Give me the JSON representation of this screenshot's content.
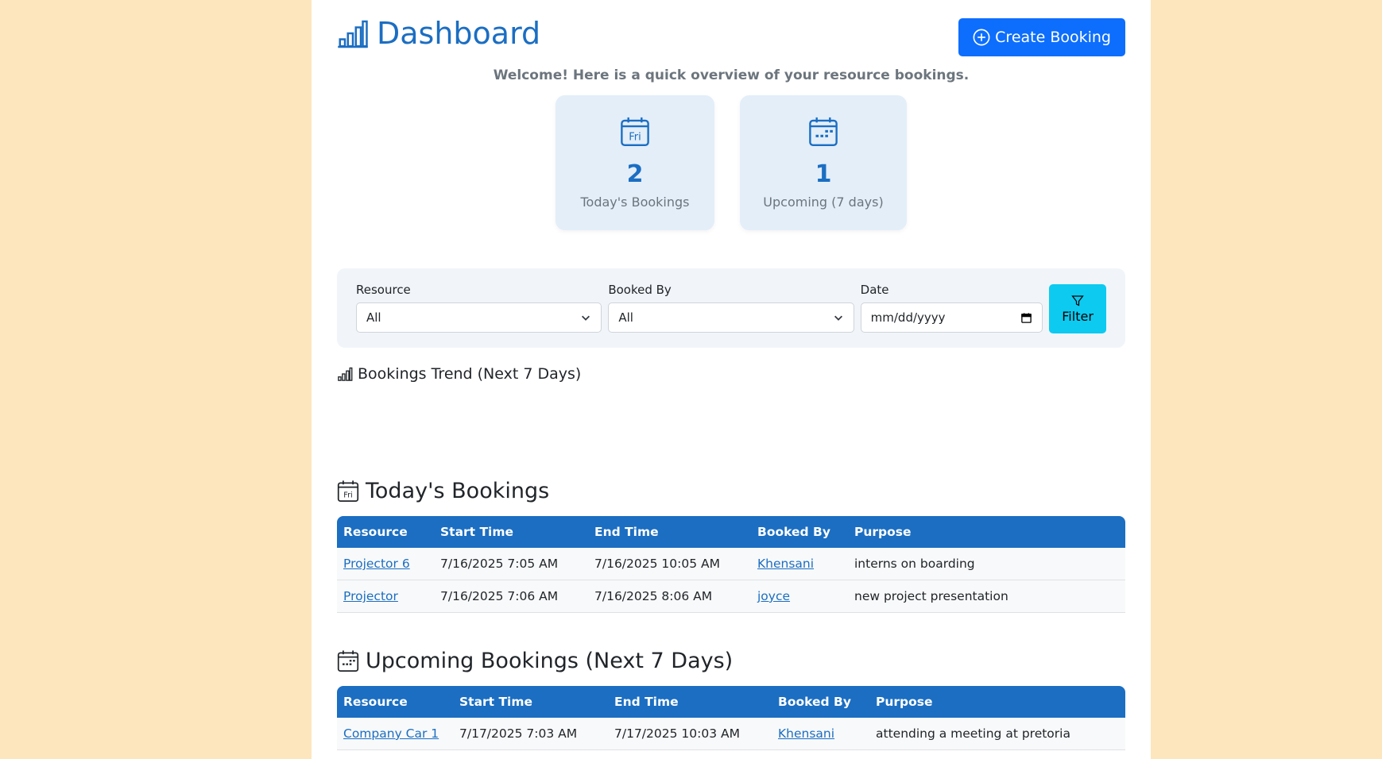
{
  "header": {
    "title": "Dashboard",
    "create_label": "Create Booking",
    "welcome": "Welcome! Here is a quick overview of your resource bookings."
  },
  "stats": [
    {
      "value": "2",
      "label": "Today's Bookings",
      "icon": "calendar-day-icon",
      "icon_text": "Fri"
    },
    {
      "value": "1",
      "label": "Upcoming (7 days)",
      "icon": "calendar-week-icon"
    }
  ],
  "filter": {
    "resource_label": "Resource",
    "resource_value": "All",
    "booked_by_label": "Booked By",
    "booked_by_value": "All",
    "date_label": "Date",
    "date_placeholder": "mm/dd/yyyy",
    "button_label": "Filter"
  },
  "trend": {
    "title": "Bookings Trend (Next 7 Days)"
  },
  "today": {
    "title": "Today's Bookings",
    "icon_text": "Fri",
    "columns": [
      "Resource",
      "Start Time",
      "End Time",
      "Booked By",
      "Purpose"
    ],
    "rows": [
      {
        "resource": "Projector 6",
        "start": "7/16/2025 7:05 AM",
        "end": "7/16/2025 10:05 AM",
        "by": "Khensani",
        "purpose": "interns on boarding"
      },
      {
        "resource": "Projector",
        "start": "7/16/2025 7:06 AM",
        "end": "7/16/2025 8:06 AM",
        "by": "joyce",
        "purpose": "new project presentation"
      }
    ]
  },
  "upcoming": {
    "title": "Upcoming Bookings (Next 7 Days)",
    "columns": [
      "Resource",
      "Start Time",
      "End Time",
      "Booked By",
      "Purpose"
    ],
    "rows": [
      {
        "resource": "Company Car 1",
        "start": "7/17/2025 7:03 AM",
        "end": "7/17/2025 10:03 AM",
        "by": "Khensani",
        "purpose": "attending a meeting at pretoria"
      }
    ]
  },
  "colors": {
    "accent": "#1b6ec2",
    "primary_button": "#0d6efd",
    "filter_button": "#0dcaf0",
    "background": "#fde6bd"
  }
}
